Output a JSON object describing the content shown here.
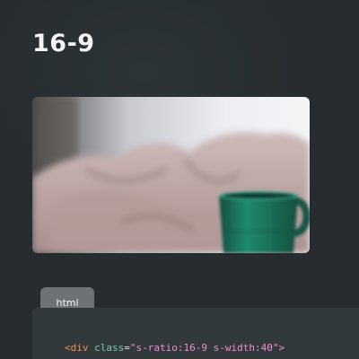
{
  "page": {
    "title": "16-9"
  },
  "tab": {
    "label": "html"
  },
  "code": {
    "tag_open": "<div",
    "attr_name": "class",
    "equals": "=",
    "attr_value": "\"s-ratio:16-9 s-width:40\"",
    "tag_close": ">"
  },
  "colors": {
    "background": "#262c2f",
    "tab": "#6c7275",
    "code_panel": "#32393c",
    "mug": "#1f8a6e"
  }
}
